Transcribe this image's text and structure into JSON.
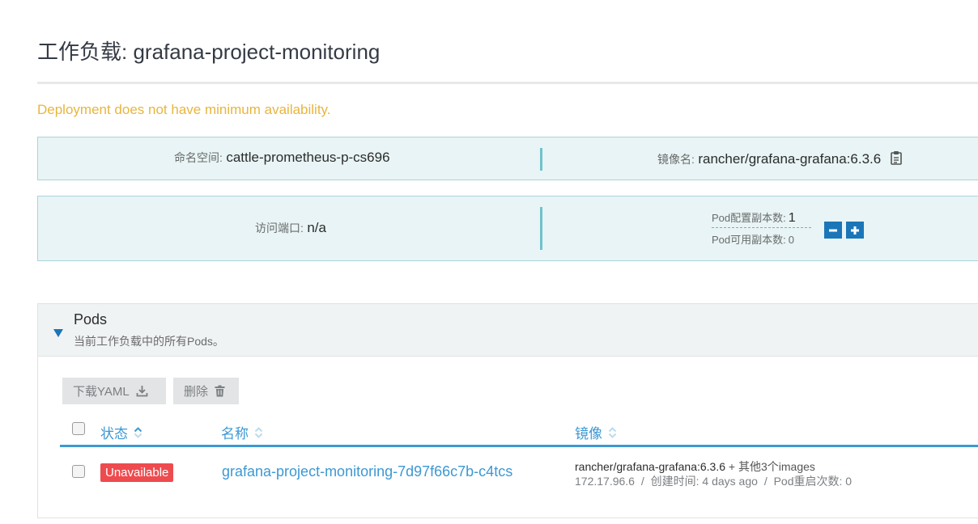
{
  "header": {
    "title": "工作负载: grafana-project-monitoring"
  },
  "warning": "Deployment does not have minimum availability.",
  "info": {
    "namespace_label": "命名空间:",
    "namespace_value": "cattle-prometheus-p-cs696",
    "image_label": "镜像名:",
    "image_value": "rancher/grafana-grafana:6.3.6",
    "port_label": "访问端口:",
    "port_value": "n/a",
    "config_replicas_label": "Pod配置副本数:",
    "config_replicas_value": "1",
    "available_replicas_label": "Pod可用副本数:",
    "available_replicas_value": "0"
  },
  "pods": {
    "title": "Pods",
    "subtitle": "当前工作负载中的所有Pods。",
    "download_yaml_label": "下载YAML",
    "delete_label": "删除",
    "columns": {
      "status": "状态",
      "name": "名称",
      "image": "镜像"
    },
    "rows": [
      {
        "status": "Unavailable",
        "name": "grafana-project-monitoring-7d97f66c7b-c4tcs",
        "image": "rancher/grafana-grafana:6.3.6",
        "image_more": "+ 其他3个images",
        "ip": "172.17.96.6",
        "sep1": "/",
        "created": "创建时间: 4 days ago",
        "sep2": "/",
        "restarts": "Pod重启次数: 0"
      }
    ]
  },
  "colors": {
    "accent": "#3d98d3",
    "warning": "#e8b53e",
    "danger": "#ee4b4f",
    "info_bg": "#e8f4f5",
    "scale_button": "#1a76b8"
  },
  "icons": {
    "copy": "copy-icon",
    "minus": "minus-icon",
    "plus": "plus-icon",
    "collapse": "triangle-down-icon",
    "download": "download-icon",
    "trash": "trash-icon",
    "sort": "sort-icon"
  }
}
